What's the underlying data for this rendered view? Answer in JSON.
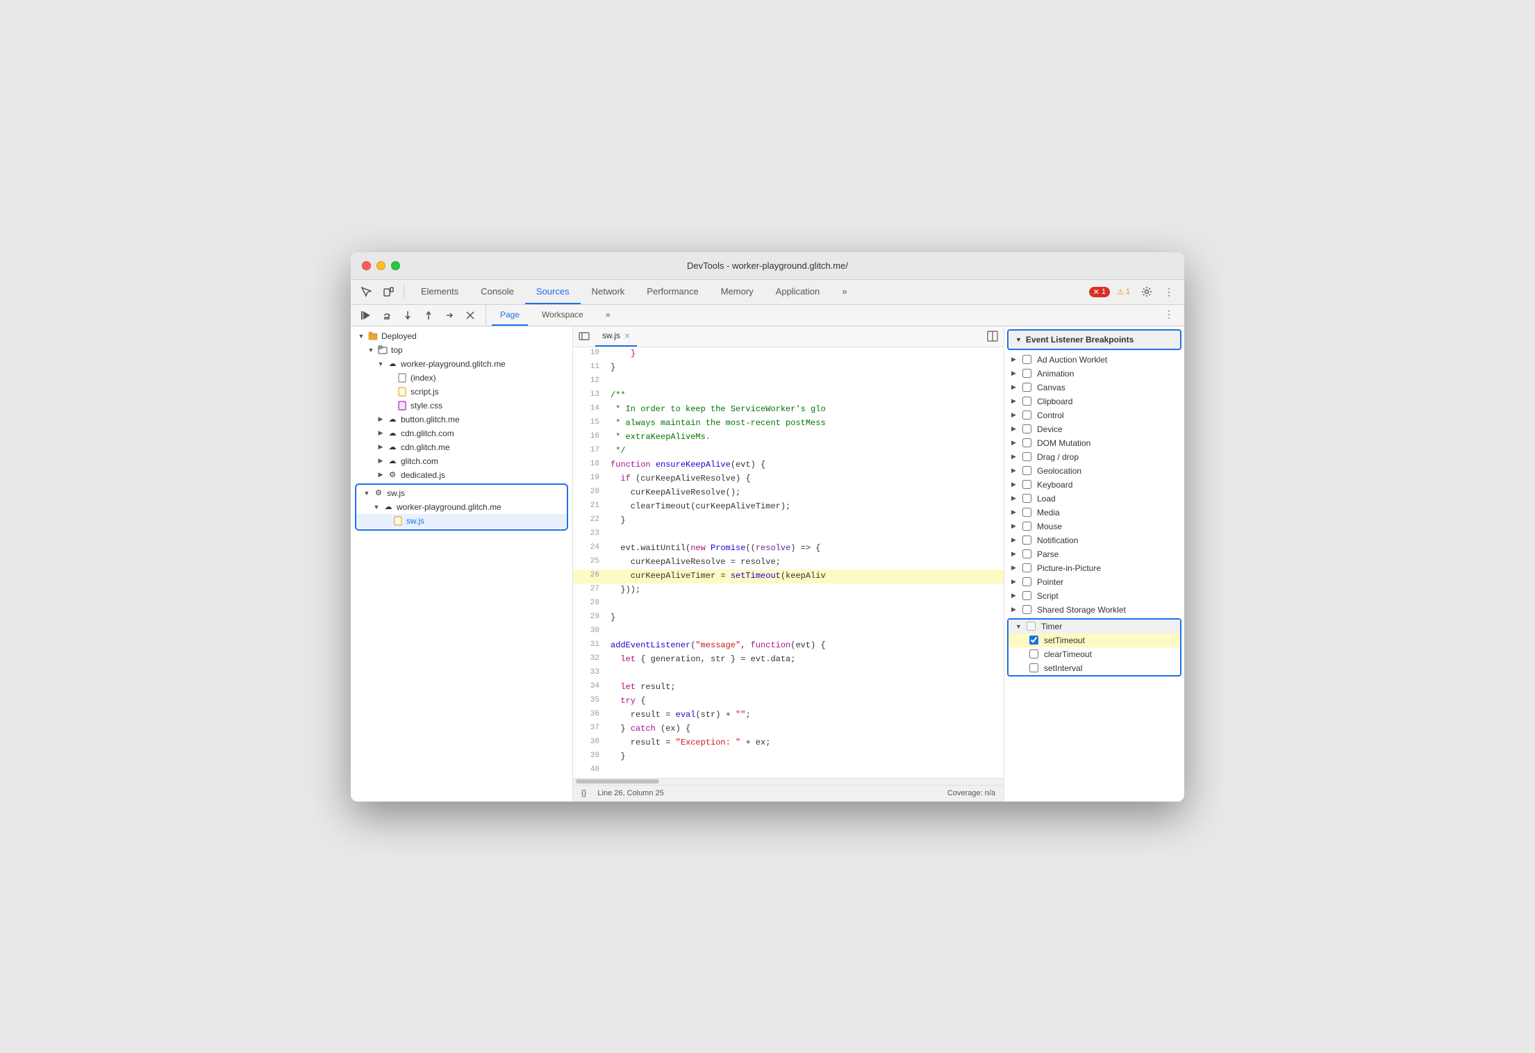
{
  "window": {
    "title": "DevTools - worker-playground.glitch.me/"
  },
  "toolbar": {
    "tabs": [
      {
        "label": "Elements",
        "active": false
      },
      {
        "label": "Console",
        "active": false
      },
      {
        "label": "Sources",
        "active": true
      },
      {
        "label": "Network",
        "active": false
      },
      {
        "label": "Performance",
        "active": false
      },
      {
        "label": "Memory",
        "active": false
      },
      {
        "label": "Application",
        "active": false
      }
    ],
    "more_tabs": "»",
    "error_count": "1",
    "warning_count": "1"
  },
  "sources": {
    "tabs": [
      {
        "label": "Page",
        "active": true
      },
      {
        "label": "Workspace",
        "active": false
      }
    ],
    "more": "»"
  },
  "file_tree": {
    "items": [
      {
        "label": "Deployed",
        "indent": 0,
        "type": "folder",
        "expanded": true
      },
      {
        "label": "top",
        "indent": 1,
        "type": "folder",
        "expanded": true
      },
      {
        "label": "worker-playground.glitch.me",
        "indent": 2,
        "type": "cloud-folder",
        "expanded": true
      },
      {
        "label": "(index)",
        "indent": 3,
        "type": "file"
      },
      {
        "label": "script.js",
        "indent": 3,
        "type": "js-file"
      },
      {
        "label": "style.css",
        "indent": 3,
        "type": "css-file"
      },
      {
        "label": "button.glitch.me",
        "indent": 2,
        "type": "cloud-folder",
        "expanded": false
      },
      {
        "label": "cdn.glitch.com",
        "indent": 2,
        "type": "cloud-folder",
        "expanded": false
      },
      {
        "label": "cdn.glitch.me",
        "indent": 2,
        "type": "cloud-folder",
        "expanded": false
      },
      {
        "label": "glitch.com",
        "indent": 2,
        "type": "cloud-folder",
        "expanded": false
      },
      {
        "label": "dedicated.js",
        "indent": 2,
        "type": "gear-file",
        "expanded": false
      },
      {
        "label": "sw.js",
        "indent": 1,
        "type": "gear-folder",
        "expanded": true,
        "selected_group": true
      },
      {
        "label": "worker-playground.glitch.me",
        "indent": 2,
        "type": "cloud-folder",
        "expanded": true
      },
      {
        "label": "sw.js",
        "indent": 3,
        "type": "js-file",
        "selected": true
      }
    ]
  },
  "code_file": {
    "name": "sw.js",
    "lines": [
      {
        "num": 10,
        "content": "    }"
      },
      {
        "num": 11,
        "content": "}"
      },
      {
        "num": 12,
        "content": ""
      },
      {
        "num": 13,
        "content": "/**",
        "comment": true
      },
      {
        "num": 14,
        "content": " * In order to keep the ServiceWorker's glo",
        "comment": true
      },
      {
        "num": 15,
        "content": " * always maintain the most-recent postMess",
        "comment": true
      },
      {
        "num": 16,
        "content": " * extraKeepAliveMs.",
        "comment": true
      },
      {
        "num": 17,
        "content": " */",
        "comment": true
      },
      {
        "num": 18,
        "content": "function ensureKeepAlive(evt) {",
        "fn": "ensureKeepAlive"
      },
      {
        "num": 19,
        "content": "  if (curKeepAliveResolve) {"
      },
      {
        "num": 20,
        "content": "    curKeepAliveResolve();"
      },
      {
        "num": 21,
        "content": "    clearTimeout(curKeepAliveTimer);"
      },
      {
        "num": 22,
        "content": "  }"
      },
      {
        "num": 23,
        "content": ""
      },
      {
        "num": 24,
        "content": "  evt.waitUntil(new Promise((resolve) => {"
      },
      {
        "num": 25,
        "content": "    curKeepAliveResolve = resolve;"
      },
      {
        "num": 26,
        "content": "    curKeepAliveTimer = setTimeout(keepAliv",
        "highlighted": true
      },
      {
        "num": 27,
        "content": "  }));"
      },
      {
        "num": 28,
        "content": ""
      },
      {
        "num": 29,
        "content": "}"
      },
      {
        "num": 30,
        "content": ""
      },
      {
        "num": 31,
        "content": "addEventListener(\"message\", function(evt) {"
      },
      {
        "num": 32,
        "content": "  let { generation, str } = evt.data;"
      },
      {
        "num": 33,
        "content": ""
      },
      {
        "num": 34,
        "content": "  let result;"
      },
      {
        "num": 35,
        "content": "  try {"
      },
      {
        "num": 36,
        "content": "    result = eval(str) + \"\";"
      },
      {
        "num": 37,
        "content": "  } catch (ex) {"
      },
      {
        "num": 38,
        "content": "    result = \"Exception: \" + ex;"
      },
      {
        "num": 39,
        "content": "  }"
      },
      {
        "num": 40,
        "content": ""
      }
    ],
    "status": "Line 26, Column 25",
    "coverage": "Coverage: n/a"
  },
  "breakpoints": {
    "section_title": "Event Listener Breakpoints",
    "categories": [
      {
        "label": "Ad Auction Worklet",
        "expanded": false,
        "checked": false
      },
      {
        "label": "Animation",
        "expanded": false,
        "checked": false
      },
      {
        "label": "Canvas",
        "expanded": false,
        "checked": false
      },
      {
        "label": "Clipboard",
        "expanded": false,
        "checked": false
      },
      {
        "label": "Control",
        "expanded": false,
        "checked": false
      },
      {
        "label": "Device",
        "expanded": false,
        "checked": false
      },
      {
        "label": "DOM Mutation",
        "expanded": false,
        "checked": false
      },
      {
        "label": "Drag / drop",
        "expanded": false,
        "checked": false
      },
      {
        "label": "Geolocation",
        "expanded": false,
        "checked": false
      },
      {
        "label": "Keyboard",
        "expanded": false,
        "checked": false
      },
      {
        "label": "Load",
        "expanded": false,
        "checked": false
      },
      {
        "label": "Media",
        "expanded": false,
        "checked": false
      },
      {
        "label": "Mouse",
        "expanded": false,
        "checked": false
      },
      {
        "label": "Notification",
        "expanded": false,
        "checked": false
      },
      {
        "label": "Parse",
        "expanded": false,
        "checked": false
      },
      {
        "label": "Picture-in-Picture",
        "expanded": false,
        "checked": false
      },
      {
        "label": "Pointer",
        "expanded": false,
        "checked": false
      },
      {
        "label": "Script",
        "expanded": false,
        "checked": false
      },
      {
        "label": "Shared Storage Worklet",
        "expanded": false,
        "checked": false
      },
      {
        "label": "Timer",
        "expanded": true,
        "checked": false,
        "partial": true
      }
    ],
    "timer_items": [
      {
        "label": "setTimeout",
        "checked": true,
        "highlighted": true
      },
      {
        "label": "clearTimeout",
        "checked": false
      },
      {
        "label": "setInterval",
        "checked": false
      }
    ]
  },
  "icons": {
    "cursor": "⬚",
    "inspect": "◫",
    "chevron_down": "▼",
    "chevron_right": "▶",
    "close": "×",
    "gear": "⚙",
    "more": "⋮",
    "error": "✕",
    "warning": "!",
    "folder": "📁",
    "file": "📄",
    "resume": "▶",
    "step_over": "↷",
    "step_into": "↓",
    "step_out": "↑",
    "deactivate": "⊘"
  }
}
